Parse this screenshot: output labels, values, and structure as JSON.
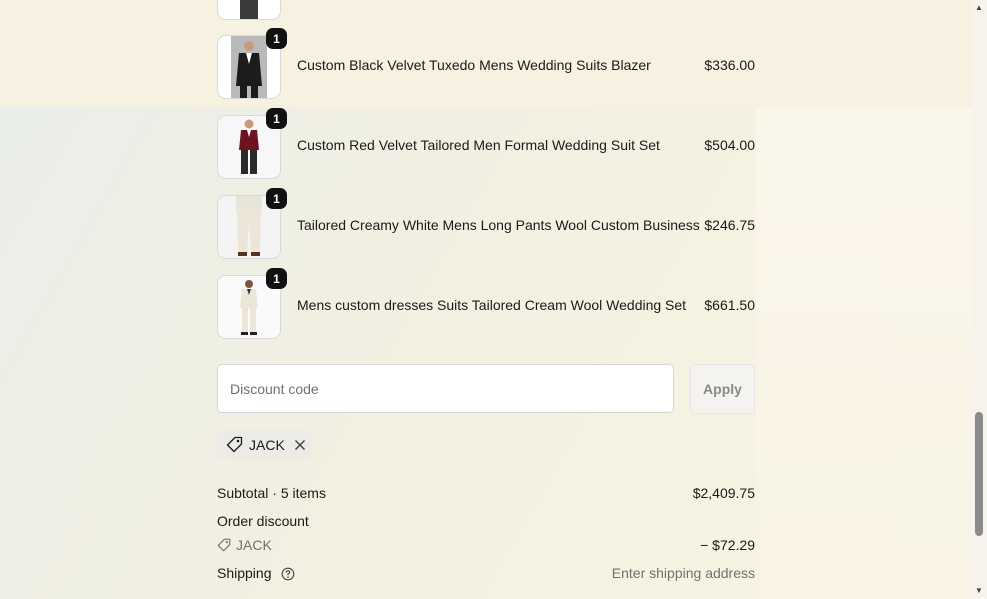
{
  "items": [
    {
      "name": "Custom Black Velvet Tuxedo Mens Wedding Suits Blazer",
      "price": "$336.00",
      "qty": "1"
    },
    {
      "name": "Custom Red Velvet Tailored Men Formal Wedding Suit Set",
      "price": "$504.00",
      "qty": "1"
    },
    {
      "name": "Tailored Creamy White Mens Long Pants Wool Custom Business",
      "price": "$246.75",
      "qty": "1"
    },
    {
      "name": "Mens custom dresses Suits Tailored Cream Wool Wedding Set",
      "price": "$661.50",
      "qty": "1"
    }
  ],
  "discount": {
    "placeholder": "Discount code",
    "apply_label": "Apply",
    "applied_code": "JACK"
  },
  "summary": {
    "subtotal_label": "Subtotal · 5 items",
    "subtotal_value": "$2,409.75",
    "order_discount_label": "Order discount",
    "order_discount_code": "JACK",
    "order_discount_value": "− $72.29",
    "shipping_label": "Shipping",
    "shipping_value": "Enter shipping address"
  },
  "colors": {
    "badge": "#111111",
    "suit_black": "#1c1c1c",
    "suit_red": "#6e1420",
    "suit_cream": "#ece6d8"
  }
}
